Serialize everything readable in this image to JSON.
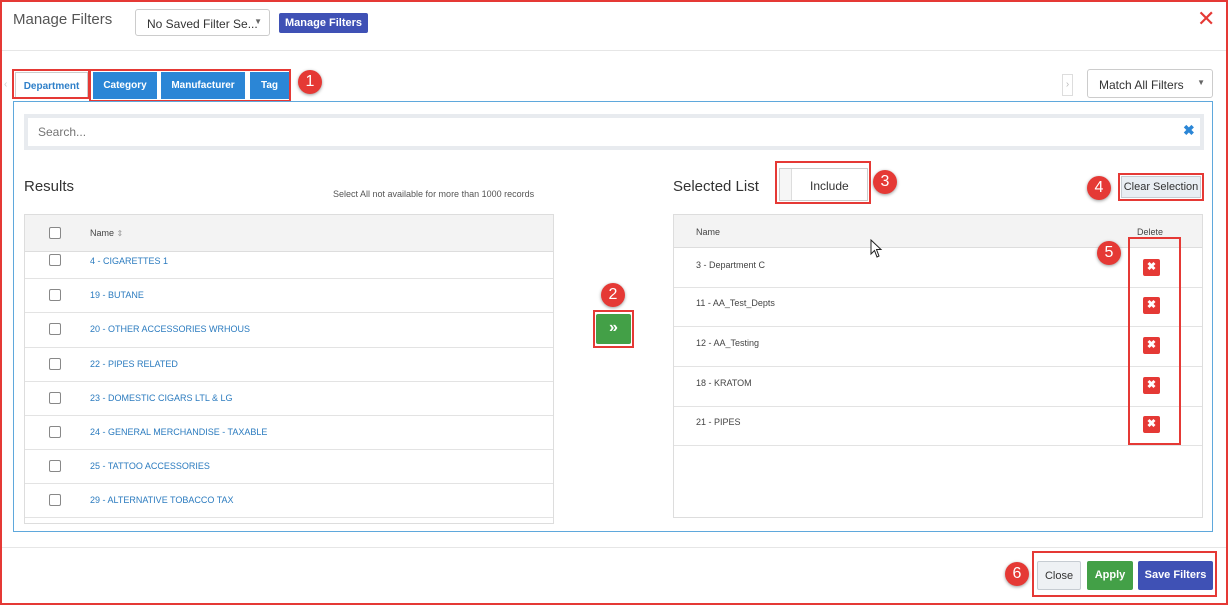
{
  "header": {
    "title": "Manage Filters",
    "saved_filter_value": "No Saved Filter Se...",
    "manage_button": "Manage Filters",
    "close_glyph": "✕"
  },
  "tabs": [
    {
      "label": "Department",
      "active": true
    },
    {
      "label": "Category",
      "active": false
    },
    {
      "label": "Manufacturer",
      "active": false
    },
    {
      "label": "Tag",
      "active": false
    }
  ],
  "match_select": {
    "value": "Match All Filters"
  },
  "search": {
    "placeholder": "Search...",
    "clear_glyph": "✖"
  },
  "results": {
    "title": "Results",
    "note": "Select All not available for more than 1000 records",
    "column_name": "Name",
    "rows": [
      "4 - CIGARETTES 1",
      "19 - BUTANE",
      "20 - OTHER ACCESSORIES WRHOUS",
      "22 - PIPES RELATED",
      "23 - DOMESTIC CIGARS LTL & LG",
      "24 - GENERAL MERCHANDISE - TAXABLE",
      "25 - TATTOO ACCESSORIES",
      "29 - ALTERNATIVE TOBACCO TAX"
    ]
  },
  "move_button_glyph": "»",
  "selected": {
    "title": "Selected List",
    "mode_label": "Include",
    "clear_label": "Clear Selection",
    "column_name": "Name",
    "column_delete": "Delete",
    "delete_glyph": "✖",
    "rows": [
      "3 - Department C",
      "11 - AA_Test_Depts",
      "12 - AA_Testing",
      "18 - KRATOM",
      "21 - PIPES"
    ]
  },
  "footer": {
    "close": "Close",
    "apply": "Apply",
    "save": "Save Filters"
  },
  "badges": [
    "1",
    "2",
    "3",
    "4",
    "5",
    "6"
  ],
  "colors": {
    "accent_blue": "#2b86d6",
    "green": "#43a047",
    "indigo": "#3f51b5",
    "red": "#e53935"
  }
}
